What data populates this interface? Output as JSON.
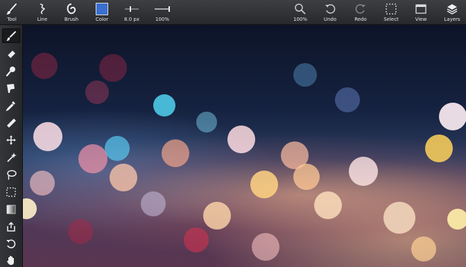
{
  "toolbar": {
    "tool_label": "Tool",
    "line_label": "Line",
    "brush_label": "Brush",
    "color_label": "Color",
    "color_value": "#3a6fd0",
    "size_label": "8.0 px",
    "opacity_label": "100%",
    "zoom_label": "100%",
    "undo_label": "Undo",
    "redo_label": "Redo",
    "select_label": "Select",
    "view_label": "View",
    "layers_label": "Layers"
  },
  "sidebar": {
    "tools": [
      {
        "name": "brush-icon"
      },
      {
        "name": "eraser-icon"
      },
      {
        "name": "smudge-icon"
      },
      {
        "name": "fill-bucket-icon"
      },
      {
        "name": "eyedropper-icon"
      },
      {
        "name": "ruler-icon"
      },
      {
        "name": "move-icon"
      },
      {
        "name": "magic-wand-icon"
      },
      {
        "name": "lasso-icon"
      },
      {
        "name": "marquee-select-icon"
      },
      {
        "name": "gradient-icon"
      },
      {
        "name": "share-icon"
      },
      {
        "name": "rotate-icon"
      },
      {
        "name": "hand-icon"
      }
    ]
  }
}
